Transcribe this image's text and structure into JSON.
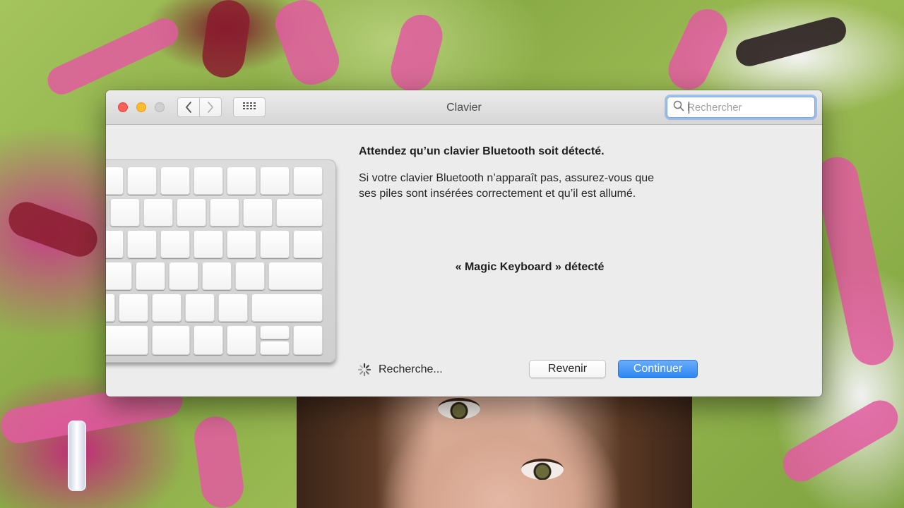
{
  "window": {
    "title": "Clavier"
  },
  "toolbar": {
    "back_icon": "chevron-left-icon",
    "forward_icon": "chevron-right-icon",
    "grid_icon": "show-all-grid-icon"
  },
  "search": {
    "placeholder": "Rechercher",
    "value": ""
  },
  "content": {
    "heading": "Attendez qu’un clavier Bluetooth soit détecté.",
    "description_line1": "Si votre clavier Bluetooth n’apparaît pas, assurez-vous que",
    "description_line2": "ses piles sont insérées correctement et qu’il est allumé.",
    "detected": "« Magic Keyboard » détecté",
    "status": "Recherche..."
  },
  "buttons": {
    "back_label": "Revenir",
    "continue_label": "Continuer"
  },
  "colors": {
    "accent": "#2e86f4",
    "close": "#fc5f57",
    "minimize": "#fdbc2e"
  }
}
